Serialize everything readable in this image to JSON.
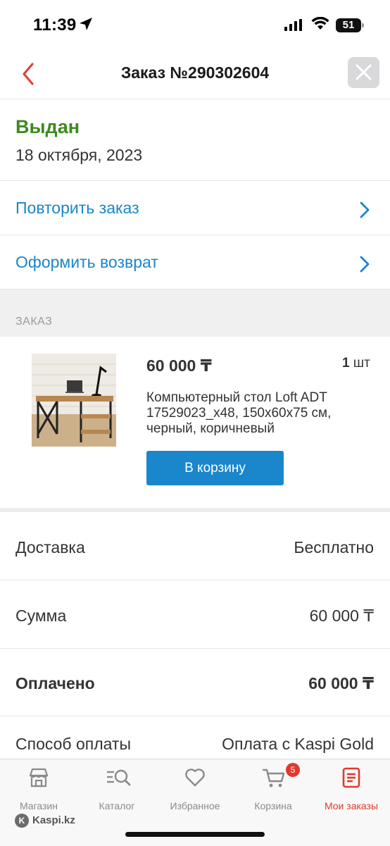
{
  "status_bar": {
    "time": "11:39",
    "battery": "51"
  },
  "header": {
    "title": "Заказ №290302604"
  },
  "order": {
    "status": "Выдан",
    "date": "18 октября, 2023",
    "status_color": "#3d8a1e"
  },
  "actions": [
    {
      "label": "Повторить заказ"
    },
    {
      "label": "Оформить возврат"
    }
  ],
  "section_label": "ЗАКАЗ",
  "product": {
    "price": "60 000 ₸",
    "quantity": "1",
    "quantity_unit": "шт",
    "name": "Компьютерный стол Loft ADT 17529023_x48, 150x60x75 см, черный, коричневый",
    "cart_button": "В корзину"
  },
  "summary": [
    {
      "label": "Доставка",
      "value": "Бесплатно"
    },
    {
      "label": "Сумма",
      "value": "60 000 ₸"
    },
    {
      "label": "Оплачено",
      "value": "60 000 ₸"
    },
    {
      "label": "Способ оплаты",
      "value": "Оплата с Kaspi Gold"
    }
  ],
  "tabs": [
    {
      "label": "Магазин",
      "icon": "store-icon"
    },
    {
      "label": "Каталог",
      "icon": "catalog-search-icon"
    },
    {
      "label": "Избранное",
      "icon": "heart-icon"
    },
    {
      "label": "Корзина",
      "icon": "cart-icon",
      "badge": "5"
    },
    {
      "label": "Мои заказы",
      "icon": "orders-icon",
      "active": true
    }
  ],
  "footer": {
    "brand": "Kaspi.kz"
  },
  "colors": {
    "accent": "#1a86cc",
    "active_tab": "#e03a2e",
    "link": "#1a86c8"
  }
}
